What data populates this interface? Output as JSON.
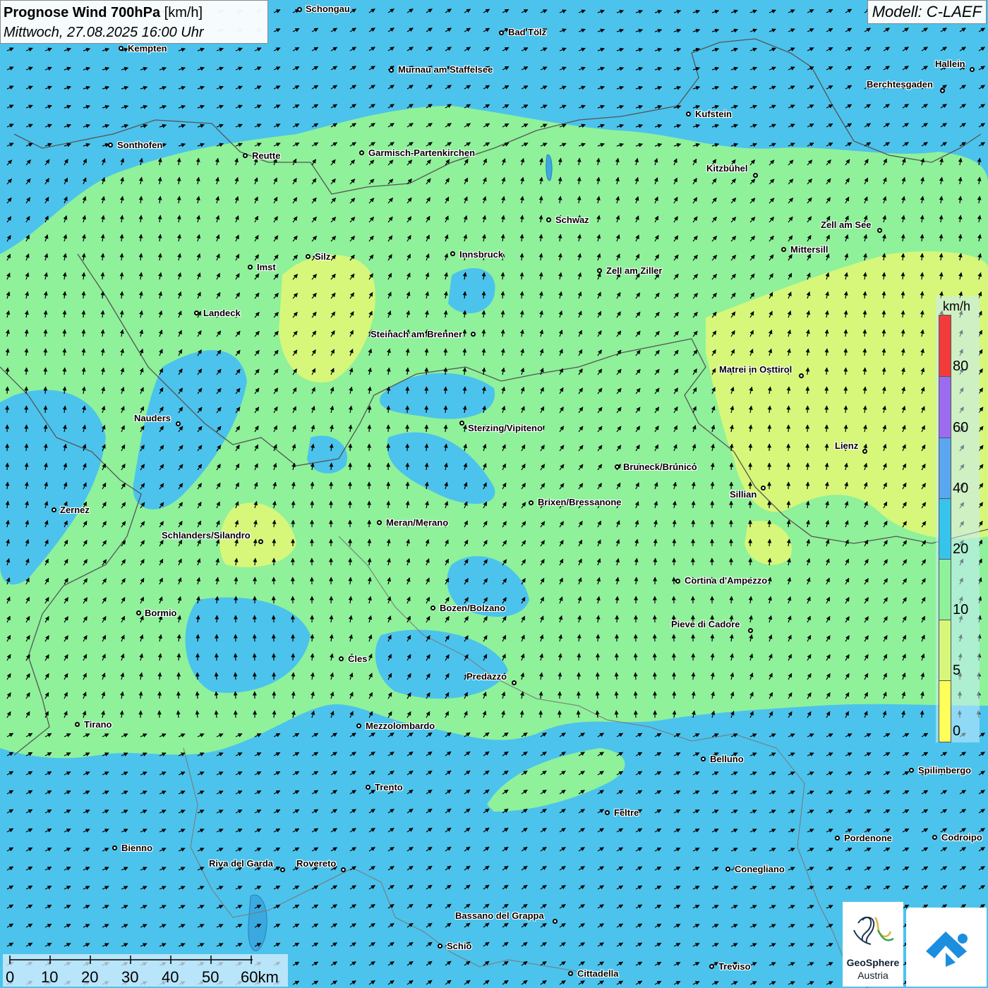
{
  "header": {
    "title_bold": "Prognose Wind 700hPa",
    "title_unit": "[km/h]",
    "datetime": "Mittwoch, 27.08.2025 16:00 Uhr",
    "model": "Modell: C-LAEF"
  },
  "legend": {
    "unit": "km/h",
    "classes": [
      {
        "label": "0",
        "color": "#ffff59"
      },
      {
        "label": "5",
        "color": "#d7f77a"
      },
      {
        "label": "10",
        "color": "#8ff19a"
      },
      {
        "label": "20",
        "color": "#36c4ec"
      },
      {
        "label": "40",
        "color": "#5aa6f0"
      },
      {
        "label": "60",
        "color": "#9b6cf0"
      },
      {
        "label": "80",
        "color": "#f23c3c"
      }
    ]
  },
  "scale_bar": {
    "labels": [
      "0",
      "10",
      "20",
      "30",
      "40",
      "50",
      "60km"
    ]
  },
  "cities": [
    {
      "name": "Schongau"
    },
    {
      "name": "Bad Tölz"
    },
    {
      "name": "Kempten"
    },
    {
      "name": "Murnau am Staffelsee"
    },
    {
      "name": "Hallein"
    },
    {
      "name": "Berchtesgaden"
    },
    {
      "name": "Kufstein"
    },
    {
      "name": "Sonthofen"
    },
    {
      "name": "Reutte"
    },
    {
      "name": "Garmisch-Partenkirchen"
    },
    {
      "name": "Kitzbühel"
    },
    {
      "name": "Schwaz"
    },
    {
      "name": "Zell am See"
    },
    {
      "name": "Mittersill"
    },
    {
      "name": "Innsbruck"
    },
    {
      "name": "Silz"
    },
    {
      "name": "Imst"
    },
    {
      "name": "Zell am Ziller"
    },
    {
      "name": "Landeck"
    },
    {
      "name": "Steinach am Brenner"
    },
    {
      "name": "Matrei in Osttirol"
    },
    {
      "name": "Nauders"
    },
    {
      "name": "Sterzing/Vipiteno"
    },
    {
      "name": "Lienz"
    },
    {
      "name": "Bruneck/Brunico"
    },
    {
      "name": "Sillian"
    },
    {
      "name": "Zernez"
    },
    {
      "name": "Brixen/Bressanone"
    },
    {
      "name": "Meran/Merano"
    },
    {
      "name": "Schlanders/Silandro"
    },
    {
      "name": "Cortina d'Ampezzo"
    },
    {
      "name": "Bozen/Bolzano"
    },
    {
      "name": "Bormio"
    },
    {
      "name": "Pieve di Cadore"
    },
    {
      "name": "Cles"
    },
    {
      "name": "Predazzo"
    },
    {
      "name": "Tirano"
    },
    {
      "name": "Mezzolombardo"
    },
    {
      "name": "Belluno"
    },
    {
      "name": "Spilimbergo"
    },
    {
      "name": "Trento"
    },
    {
      "name": "Feltre"
    },
    {
      "name": "Bienno"
    },
    {
      "name": "Pordenone"
    },
    {
      "name": "Codroipo"
    },
    {
      "name": "Riva del Garda"
    },
    {
      "name": "Rovereto"
    },
    {
      "name": "Conegliano"
    },
    {
      "name": "Bassano del Grappa"
    },
    {
      "name": "Schio"
    },
    {
      "name": "Treviso"
    },
    {
      "name": "Cittadella"
    }
  ],
  "logos": {
    "geosphere_name": "GeoSphere",
    "geosphere_sub": "Austria"
  },
  "icons": [
    "geosphere-logo-icon",
    "warning-app-logo-icon"
  ]
}
